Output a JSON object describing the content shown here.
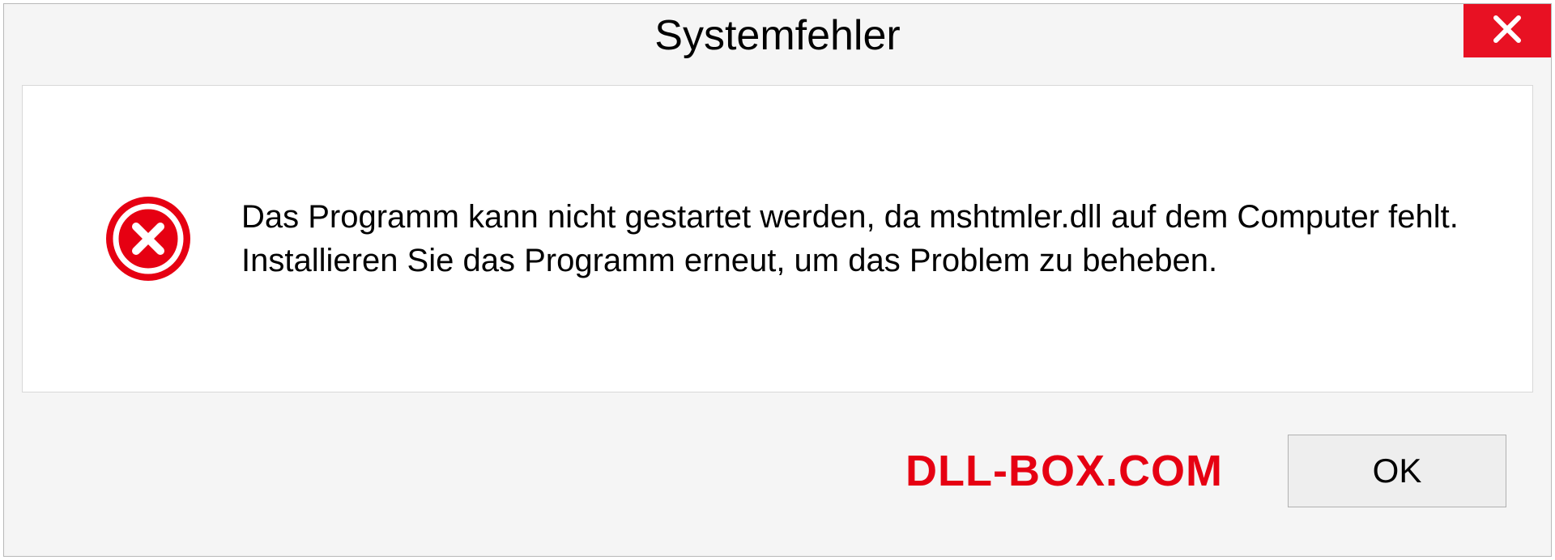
{
  "dialog": {
    "title": "Systemfehler",
    "message": "Das Programm kann nicht gestartet werden, da mshtmler.dll auf dem Computer fehlt. Installieren Sie das Programm erneut, um das Problem zu beheben.",
    "ok_label": "OK"
  },
  "watermark": "DLL-BOX.COM",
  "colors": {
    "close_bg": "#e81123",
    "error_icon": "#e60012",
    "watermark": "#e60012"
  }
}
